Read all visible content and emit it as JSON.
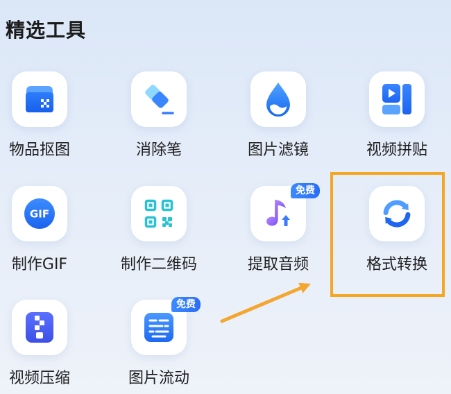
{
  "section": {
    "title": "精选工具"
  },
  "tools": [
    {
      "label": "物品抠图",
      "icon": "object-cutout-icon"
    },
    {
      "label": "消除笔",
      "icon": "eraser-icon"
    },
    {
      "label": "图片滤镜",
      "icon": "water-drop-filter-icon"
    },
    {
      "label": "视频拼贴",
      "icon": "video-collage-icon"
    },
    {
      "label": "制作GIF",
      "icon": "gif-icon",
      "icon_text": "GIF"
    },
    {
      "label": "制作二维码",
      "icon": "qr-code-icon"
    },
    {
      "label": "提取音频",
      "icon": "music-note-upload-icon",
      "badge": "免费"
    },
    {
      "label": "格式转换",
      "icon": "refresh-arrows-icon",
      "highlighted": true
    },
    {
      "label": "视频压缩",
      "icon": "zip-compress-icon"
    },
    {
      "label": "图片流动",
      "icon": "flow-lines-icon",
      "badge": "免费"
    }
  ],
  "colors": {
    "background": "#e3ecf8",
    "icon_blue": "#2f7bff",
    "badge": "#2f7bff",
    "annotation": "#f5a623"
  }
}
